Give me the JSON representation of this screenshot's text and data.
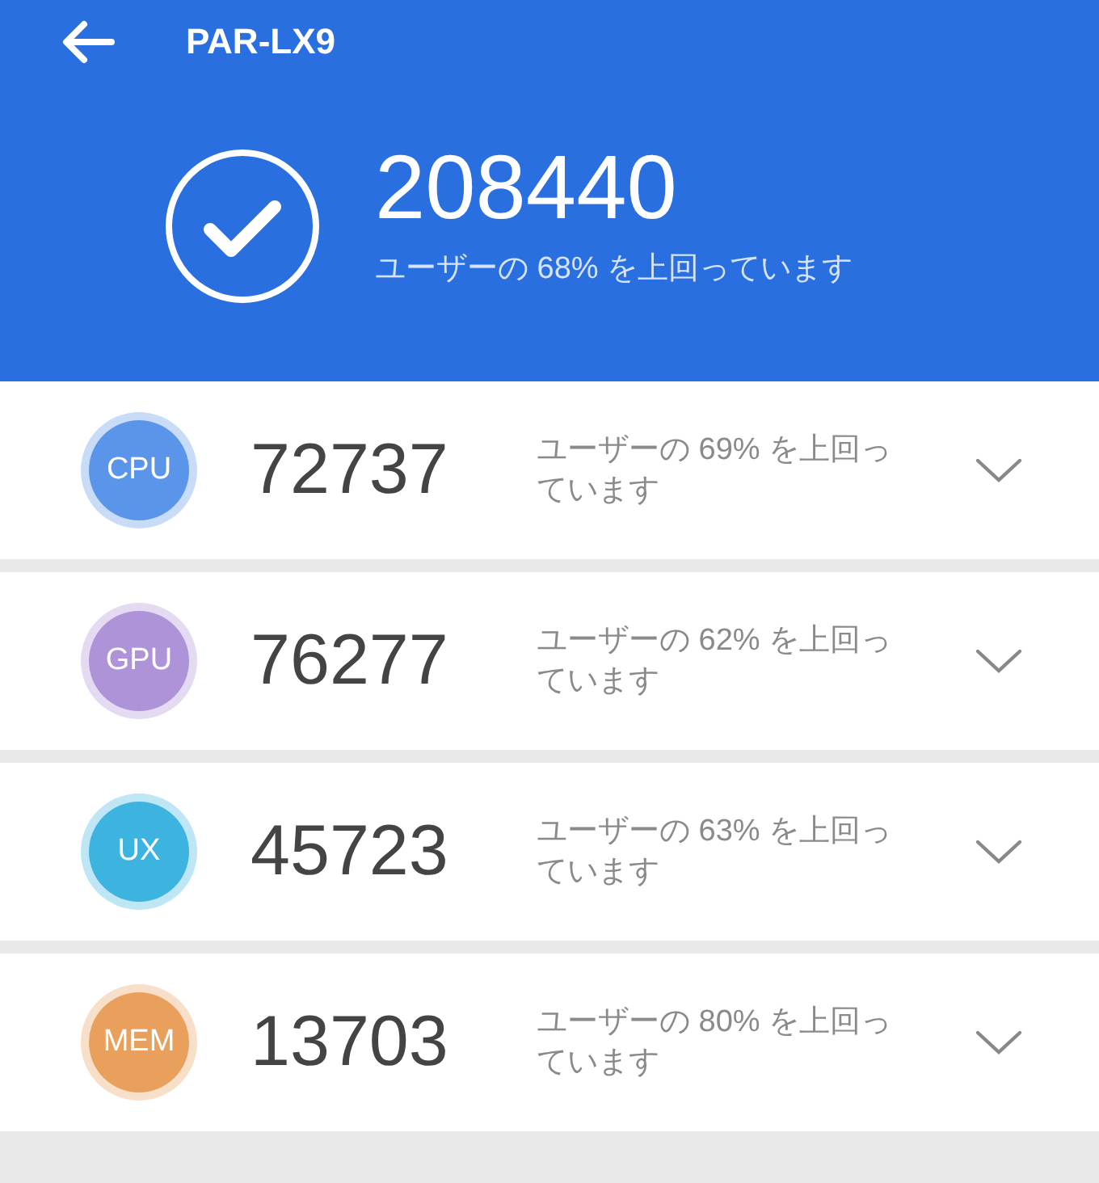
{
  "header": {
    "title": "PAR-LX9",
    "total_score": "208440",
    "summary": "ユーザーの 68% を上回っています"
  },
  "categories": [
    {
      "badge": "CPU",
      "color": "#5b95ea",
      "score": "72737",
      "summary": "ユーザーの 69% を上回っています",
      "expanded": false
    },
    {
      "badge": "GPU",
      "color": "#ae93d8",
      "score": "76277",
      "summary": "ユーザーの 62% を上回っています",
      "expanded": false
    },
    {
      "badge": "UX",
      "color": "#3db4e0",
      "score": "45723",
      "summary": "ユーザーの 63% を上回っています",
      "expanded": false
    },
    {
      "badge": "MEM",
      "color": "#e9a05c",
      "score": "13703",
      "summary": "ユーザーの 80% を上回っています",
      "expanded": false
    }
  ]
}
